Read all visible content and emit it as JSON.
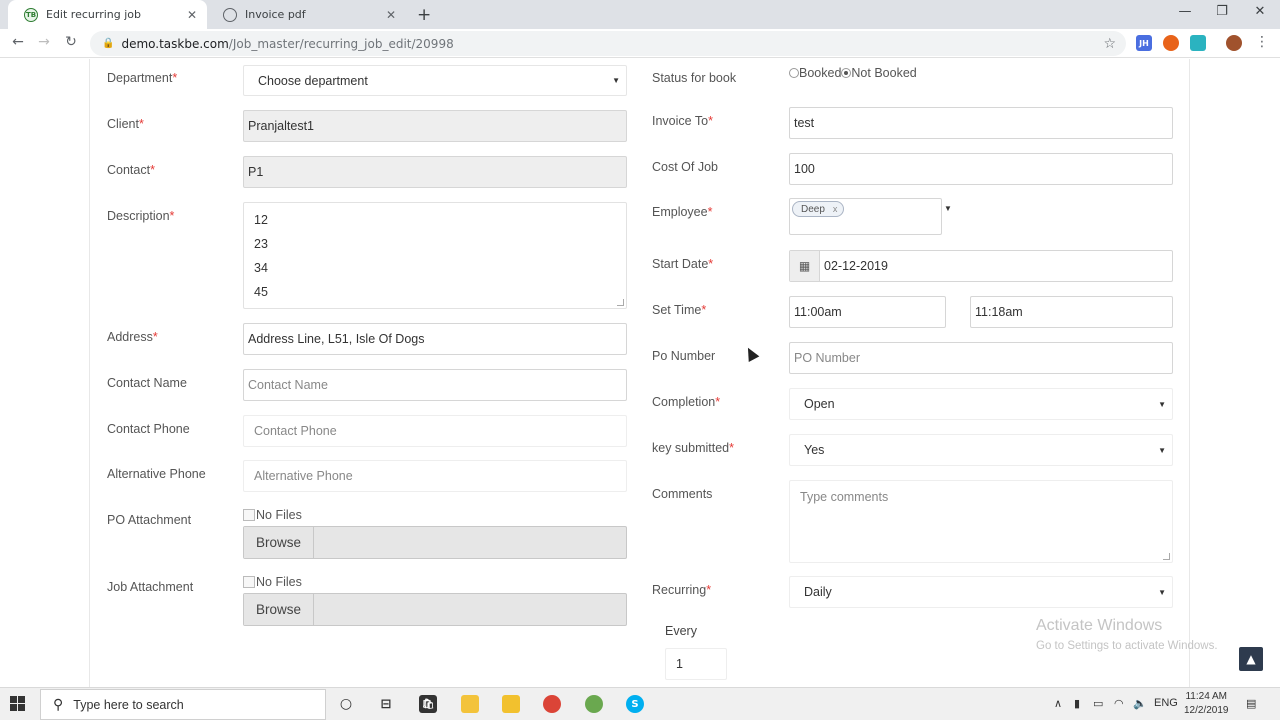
{
  "browser": {
    "tabs": [
      {
        "title": "Edit recurring job",
        "active": true,
        "favicon": "TB"
      },
      {
        "title": "Invoice pdf",
        "active": false,
        "favicon": "globe-icon"
      }
    ],
    "url_host": "demo.taskbe.com",
    "url_path": "/Job_master/recurring_job_edit/20998",
    "extensions": [
      "JH"
    ]
  },
  "form_left": {
    "department": {
      "label": "Department",
      "value": "Choose department"
    },
    "client": {
      "label": "Client",
      "value": "Pranjaltest1"
    },
    "contact": {
      "label": "Contact",
      "value": "P1"
    },
    "description": {
      "label": "Description",
      "lines": [
        "12",
        "23",
        "34",
        "45"
      ]
    },
    "address": {
      "label": "Address",
      "value": "Address Line, L51, Isle Of Dogs"
    },
    "contact_name": {
      "label": "Contact Name",
      "placeholder": "Contact Name"
    },
    "contact_phone": {
      "label": "Contact Phone",
      "placeholder": "Contact Phone"
    },
    "alternative_phone": {
      "label": "Alternative Phone",
      "placeholder": "Alternative Phone"
    },
    "po_attachment": {
      "label": "PO Attachment",
      "preview": "No Files",
      "browse": "Browse"
    },
    "job_attachment": {
      "label": "Job Attachment",
      "preview": "No Files",
      "browse": "Browse"
    }
  },
  "form_right": {
    "status_for_book": {
      "label": "Status for book",
      "options": [
        "Booked",
        "Not Booked"
      ],
      "selected": "Not Booked"
    },
    "invoice_to": {
      "label": "Invoice To",
      "value": "test"
    },
    "cost_of_job": {
      "label": "Cost Of Job",
      "value": "100"
    },
    "employee": {
      "label": "Employee",
      "chips": [
        "Deep"
      ]
    },
    "start_date": {
      "label": "Start Date",
      "value": "02-12-2019"
    },
    "set_time": {
      "label": "Set Time",
      "from": "11:00am",
      "to": "11:18am"
    },
    "po_number": {
      "label": "Po Number",
      "placeholder": "PO Number"
    },
    "completion": {
      "label": "Completion",
      "value": "Open"
    },
    "key_submitted": {
      "label": "key submitted",
      "value": "Yes"
    },
    "comments": {
      "label": "Comments",
      "placeholder": "Type comments"
    },
    "recurring": {
      "label": "Recurring",
      "value": "Daily"
    },
    "every": {
      "label": "Every",
      "value": "1"
    }
  },
  "watermark": {
    "title": "Activate Windows",
    "subtitle": "Go to Settings to activate Windows."
  },
  "taskbar": {
    "search_placeholder": "Type here to search",
    "language": "ENG",
    "time": "11:24 AM",
    "date": "12/2/2019"
  },
  "colors": {
    "required": "#e53935",
    "readonly_bg": "#eeeeee",
    "chrome_tabstrip": "#dee1e6"
  }
}
